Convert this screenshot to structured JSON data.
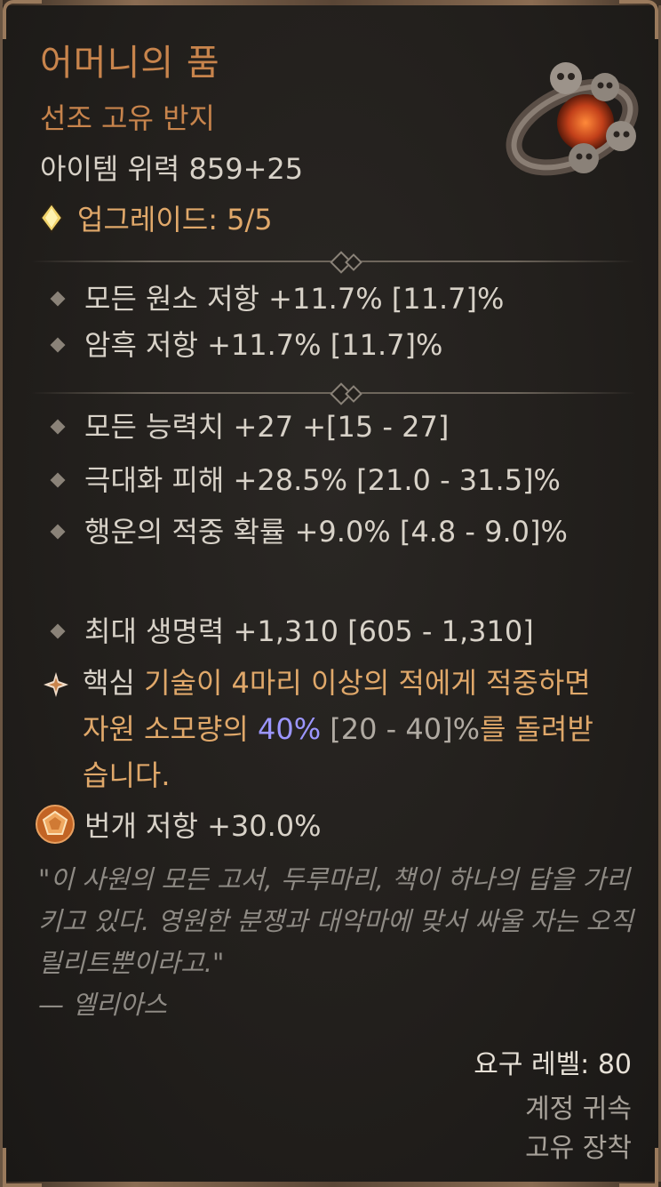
{
  "item": {
    "name": "어머니의 품",
    "type": "선조 고유 반지",
    "item_power": "아이템 위력 859+25",
    "upgrade": "업그레이드: 5/5"
  },
  "implicit_stats": [
    "모든 원소 저항 +11.7% [11.7]%",
    "암흑 저항 +11.7% [11.7]%"
  ],
  "affixes": [
    "모든 능력치 +27 +[15 - 27]",
    "극대화 피해 +28.5% [21.0 - 31.5]%",
    "행운의 적중 확률 +9.0% [4.8 - 9.0]%",
    "최대 생명력 +1,310 [605 - 1,310]"
  ],
  "legendary": {
    "keyword": "핵심",
    "text_part1": " 기술이 4마리 이상의 적에게 적중하면 자원 소모량의 ",
    "value": "40%",
    "range": " [20 - 40]%",
    "text_part2": "를 돌려받습니다."
  },
  "aspect": "번개 저항 +30.0%",
  "flavor": {
    "quote": "\"이 사원의 모든 고서, 두루마리, 책이 하나의 답을 가리키고 있다. 영원한 분쟁과 대악마에 맞서 싸울 자는 오직 릴리트뿐이라고.\"",
    "author": "— 엘리아스"
  },
  "requirements": {
    "level": "요구 레벨: 80",
    "bound": "계정 귀속",
    "equip": "고유 장착"
  },
  "colors": {
    "title": "#c8844c",
    "stat": "#d8d2c8",
    "highlight_value": "#9c96ff",
    "flavor": "#8e8a84"
  },
  "icons": {
    "upgrade": "diamond-gem-icon",
    "legendary": "star-burst-icon",
    "aspect": "pentagon-badge-icon",
    "item": "skull-ring-icon"
  }
}
